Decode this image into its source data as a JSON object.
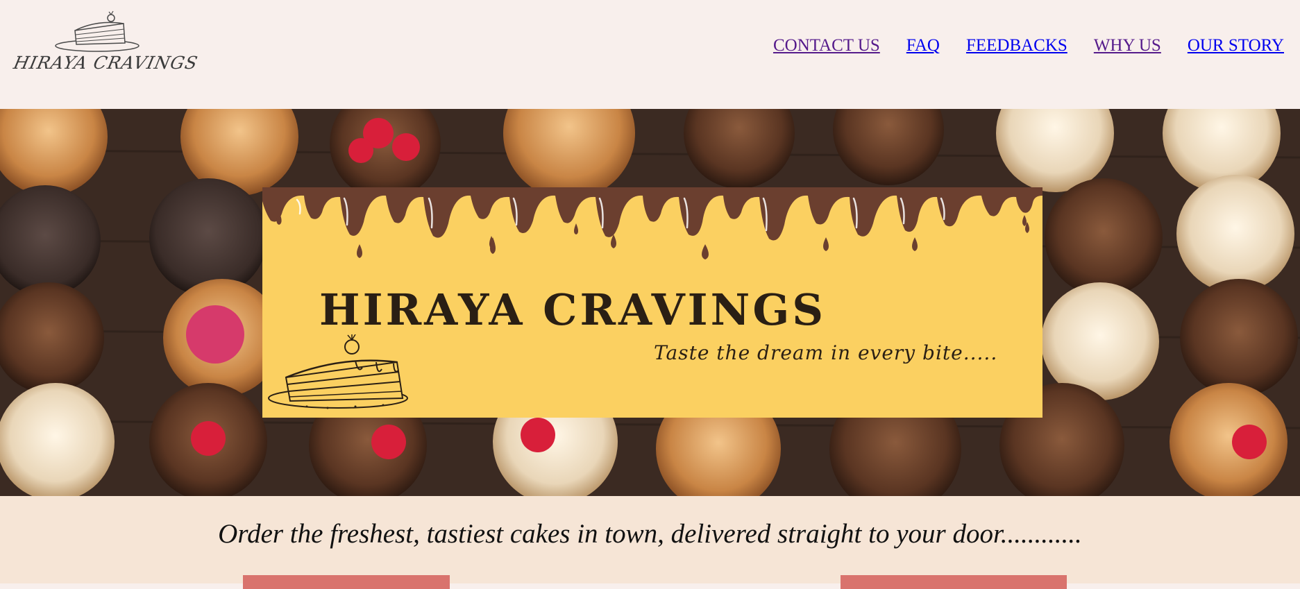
{
  "logo": {
    "text": "HIRAYA CRAVINGS"
  },
  "nav": {
    "items": [
      {
        "label": "CONTACT US",
        "state": "visited"
      },
      {
        "label": "FAQ",
        "state": "unvisited"
      },
      {
        "label": "FEEDBACKS",
        "state": "unvisited"
      },
      {
        "label": "WHY US",
        "state": "visited"
      },
      {
        "label": "OUR STORY",
        "state": "unvisited"
      }
    ]
  },
  "banner": {
    "title": "HIRAYA CRAVINGS",
    "tagline": "Taste the dream in every bite....."
  },
  "intro": {
    "text": "Order the freshest, tastiest cakes in town, delivered straight to your door............"
  },
  "colors": {
    "header_bg": "#f8efec",
    "banner_bg": "#fbd061",
    "drip": "#6b3f2f",
    "intro_bg": "#f6e5d6",
    "cta": "#d9736d"
  }
}
